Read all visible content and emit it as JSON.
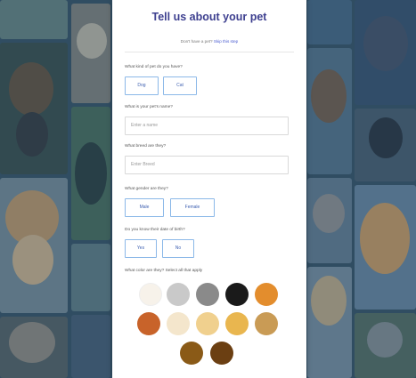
{
  "form": {
    "title": "Tell us about your pet",
    "subline_prefix": "Don't have a pet?",
    "subline_link": "Skip this step",
    "q_kind": "What kind of pet do you have?",
    "kind_options": [
      "Dog",
      "Cat"
    ],
    "q_name": "What is your pet's name?",
    "name_placeholder": "Enter a name",
    "q_breed": "What breed are they?",
    "breed_placeholder": "Enter Breed",
    "q_gender": "What gender are they?",
    "gender_options": [
      "Male",
      "Female"
    ],
    "q_fixed": "Do you know their date of birth?",
    "fixed_options": [
      "Yes",
      "No"
    ],
    "q_color": "What color are they? Select all that apply"
  },
  "colors": {
    "accent": "#3d3f8f",
    "option_border": "#8bb8e8",
    "swatches": [
      "#f7f2ea",
      "#c9c9c9",
      "#8a8a8a",
      "#1a1a1a",
      "#e38d2d",
      "#c8632a",
      "#f4e6cc",
      "#f0d08e",
      "#e9b64f",
      "#c99b55",
      "#8a5a17",
      "#6b3f12"
    ]
  }
}
